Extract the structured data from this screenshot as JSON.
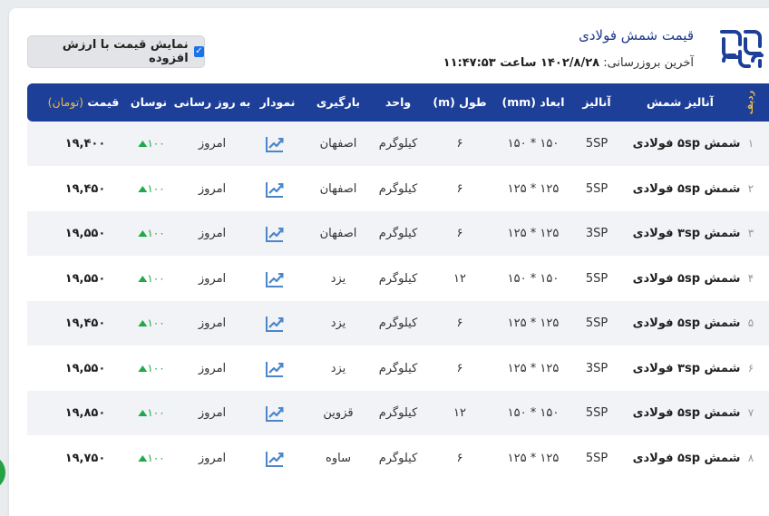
{
  "header": {
    "title": "قیمت شمش فولادی",
    "last_update_label": "آخرین بروزرسانی:",
    "last_update_value": "۱۴۰۲/۸/۲۸ ساعت ۱۱:۴۷:۵۳"
  },
  "vat_toggle": {
    "label": "نمایش قیمت با ارزش افزوده",
    "checked": true
  },
  "columns": {
    "rownum": "ردیف",
    "name": "آنالیز شمش",
    "analysis": "آنالیز",
    "dims": "ابعاد (mm)",
    "length": "طول (m)",
    "unit": "واحد",
    "loading": "بارگیری",
    "chart": "نمودار",
    "updated": "به روز رسانی",
    "change": "نوسان",
    "price": "قیمت",
    "price_unit": "(تومان)"
  },
  "rows": [
    {
      "num": "۱",
      "name": "شمش ۵sp فولادی",
      "analysis": "5SP",
      "dims": "۱۵۰ * ۱۵۰",
      "length": "۶",
      "unit": "کیلوگرم",
      "loading": "اصفهان",
      "updated": "امروز",
      "change": "۱۰۰",
      "price": "۱۹,۴۰۰"
    },
    {
      "num": "۲",
      "name": "شمش ۵sp فولادی",
      "analysis": "5SP",
      "dims": "۱۲۵ * ۱۲۵",
      "length": "۶",
      "unit": "کیلوگرم",
      "loading": "اصفهان",
      "updated": "امروز",
      "change": "۱۰۰",
      "price": "۱۹,۴۵۰"
    },
    {
      "num": "۳",
      "name": "شمش ۳sp فولادی",
      "analysis": "3SP",
      "dims": "۱۲۵ * ۱۲۵",
      "length": "۶",
      "unit": "کیلوگرم",
      "loading": "اصفهان",
      "updated": "امروز",
      "change": "۱۰۰",
      "price": "۱۹,۵۵۰"
    },
    {
      "num": "۴",
      "name": "شمش ۵sp فولادی",
      "analysis": "5SP",
      "dims": "۱۵۰ * ۱۵۰",
      "length": "۱۲",
      "unit": "کیلوگرم",
      "loading": "یزد",
      "updated": "امروز",
      "change": "۱۰۰",
      "price": "۱۹,۵۵۰"
    },
    {
      "num": "۵",
      "name": "شمش ۵sp فولادی",
      "analysis": "5SP",
      "dims": "۱۲۵ * ۱۲۵",
      "length": "۶",
      "unit": "کیلوگرم",
      "loading": "یزد",
      "updated": "امروز",
      "change": "۱۰۰",
      "price": "۱۹,۴۵۰"
    },
    {
      "num": "۶",
      "name": "شمش ۳sp فولادی",
      "analysis": "3SP",
      "dims": "۱۲۵ * ۱۲۵",
      "length": "۶",
      "unit": "کیلوگرم",
      "loading": "یزد",
      "updated": "امروز",
      "change": "۱۰۰",
      "price": "۱۹,۵۵۰"
    },
    {
      "num": "۷",
      "name": "شمش ۵sp فولادی",
      "analysis": "5SP",
      "dims": "۱۵۰ * ۱۵۰",
      "length": "۱۲",
      "unit": "کیلوگرم",
      "loading": "قزوین",
      "updated": "امروز",
      "change": "۱۰۰",
      "price": "۱۹,۸۵۰"
    },
    {
      "num": "۸",
      "name": "شمش ۵sp فولادی",
      "analysis": "5SP",
      "dims": "۱۲۵ * ۱۲۵",
      "length": "۶",
      "unit": "کیلوگرم",
      "loading": "ساوه",
      "updated": "امروز",
      "change": "۱۰۰",
      "price": "۱۹,۷۵۰"
    }
  ],
  "icons": {
    "logo": "brand-logo-icon",
    "chart": "trend-chart-icon",
    "change": "up-triangle-icon",
    "checkbox": "checkbox-checked-icon"
  },
  "colors": {
    "header_bg": "#1d3f98",
    "accent": "#e7b84a",
    "up": "#1faa4a",
    "title": "#1e3a8a"
  }
}
